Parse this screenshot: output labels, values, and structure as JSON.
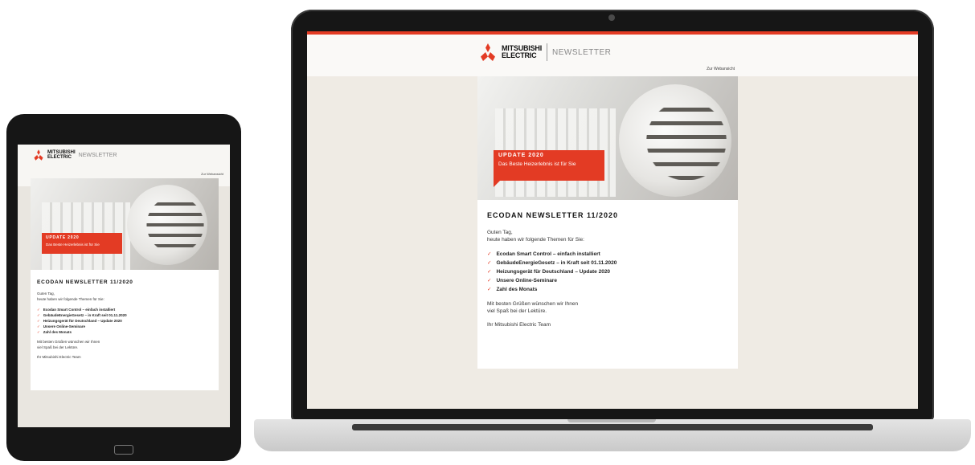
{
  "brand": {
    "name_line1": "MITSUBISHI",
    "name_line2": "ELECTRIC",
    "product": "NEWSLETTER"
  },
  "header_link": "Zur Webansicht",
  "hero": {
    "badge_title": "UPDATE 2020",
    "badge_subtitle": "Das Beste Heizerlebnis ist für Sie"
  },
  "newsletter": {
    "title": "ECODAN NEWSLETTER 11/2020",
    "greeting": "Guten Tag,",
    "intro": "heute haben wir folgende Themen für Sie:",
    "topics": [
      "Ecodan Smart Control – einfach installiert",
      "GebäudeEnergieGesetz – in Kraft seit 01.11.2020",
      "Heizungsgerät für Deutschland – Update 2020",
      "Unsere Online-Seminare",
      "Zahl des Monats"
    ],
    "closing1": "Mit besten Grüßen wünschen wir Ihnen",
    "closing2": "viel Spaß bei der Lektüre.",
    "signature": "Ihr Mitsubishi Electric Team"
  },
  "colors": {
    "accent": "#e33b24"
  },
  "icons": {
    "check": "check-icon",
    "logo": "mitsubishi-diamond-logo"
  }
}
